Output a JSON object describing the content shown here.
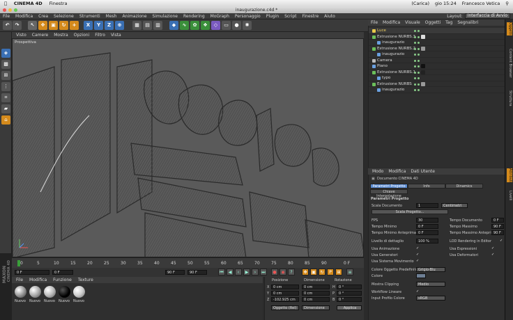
{
  "macbar": {
    "app": "CINEMA 4D",
    "menu": "Finestra",
    "charge": "(Carica)",
    "clock": "gio 15:24",
    "user": "Francesco Vetica"
  },
  "window": {
    "title": "inaugurazione.c4d *"
  },
  "menubar": {
    "items": [
      "File",
      "Modifica",
      "Crea",
      "Selezione",
      "Strumenti",
      "Mesh",
      "Animazione",
      "Simulazione",
      "Rendering",
      "MoGraph",
      "Personaggio",
      "Plugin",
      "Script",
      "Finestre",
      "Aiuto"
    ],
    "layout_label": "Layout:",
    "layout_value": "Interfaccia di Avvio"
  },
  "toolbar": {
    "x": "X",
    "y": "Y",
    "z": "Z"
  },
  "viewport": {
    "menu": [
      "Visto",
      "Camere",
      "Mostra",
      "Opzioni",
      "Filtro",
      "Vista"
    ],
    "label": "Prospettiva"
  },
  "timeline": {
    "ticks": [
      "0",
      "5",
      "10",
      "15",
      "20",
      "25",
      "30",
      "35",
      "40",
      "45",
      "50",
      "55",
      "60",
      "65",
      "70",
      "75",
      "80",
      "85",
      "90"
    ],
    "end_label": "0 F"
  },
  "transport": {
    "start": "0 F",
    "current": "0 F",
    "end": "90 F",
    "end2": "90 F"
  },
  "materials": {
    "menu": [
      "File",
      "Modifica",
      "Funzione",
      "Texture"
    ],
    "items": [
      {
        "name": "Nuovo"
      },
      {
        "name": "Nuovo"
      },
      {
        "name": "Nuovo"
      },
      {
        "name": "Nuovo"
      },
      {
        "name": "Nuovo"
      }
    ]
  },
  "maxon": {
    "brand": "MAXON",
    "product": "CINEMA 4D"
  },
  "coords": {
    "h_pos": "Posizione",
    "h_dim": "Dimensione",
    "h_rot": "Rotazione",
    "rows": [
      {
        "axis": "X",
        "pos": "0 cm",
        "dim": "0 cm",
        "rl": "H",
        "rot": "0 °"
      },
      {
        "axis": "Y",
        "pos": "0 cm",
        "dim": "0 cm",
        "rl": "P",
        "rot": "0 °"
      },
      {
        "axis": "Z",
        "pos": "-102.925 cm",
        "dim": "0 cm",
        "rl": "B",
        "rot": "0 °"
      }
    ],
    "mode1": "Oggetto (Rel)",
    "mode2": "Dimensione",
    "apply": "Applica"
  },
  "objects": {
    "menu": [
      "File",
      "Modifica",
      "Visuale",
      "Oggetti",
      "Tag",
      "Segnalibri"
    ],
    "rows": [
      {
        "name": "Luce",
        "indent": 0,
        "color": "#e8c84a"
      },
      {
        "name": "Estrusione NURBS.3",
        "indent": 0,
        "color": "#6bbf5a"
      },
      {
        "name": "inaugurazio",
        "indent": 1,
        "color": "#6aa0e0"
      },
      {
        "name": "Estrusione NURBS.2",
        "indent": 0,
        "color": "#6bbf5a"
      },
      {
        "name": "inaugurazio",
        "indent": 1,
        "color": "#6aa0e0"
      },
      {
        "name": "Camera",
        "indent": 0,
        "color": "#bbbbbb"
      },
      {
        "name": "Piano",
        "indent": 0,
        "color": "#6aa0e0"
      },
      {
        "name": "Estrusione NURBS.1",
        "indent": 0,
        "color": "#6bbf5a"
      },
      {
        "name": "typo",
        "indent": 1,
        "color": "#6aa0e0"
      },
      {
        "name": "Estrusione NURBS",
        "indent": 0,
        "color": "#6bbf5a"
      },
      {
        "name": "inaugurazio",
        "indent": 1,
        "color": "#6aa0e0"
      }
    ]
  },
  "sidetabs": [
    "Oggetti",
    "Content Browser",
    "Struttura",
    "Attributi",
    "Livelli"
  ],
  "attributes": {
    "menu": [
      "Modo",
      "Modifica",
      "Dati Utente"
    ],
    "doc": "Documento CINEMA 4D",
    "tabs": [
      "Parametri Progetto",
      "Info",
      "Dinamics"
    ],
    "tab2": "Chiave Interpolazione",
    "section": "Parametri Progetto",
    "scale_label": "Scala Documento",
    "scale_val": "1",
    "scale_unit": "Centimetri",
    "scale_btn": "Scala Progetto...",
    "fps_l": "FPS",
    "fps": "30",
    "tdoc_l": "Tempo Documento",
    "tdoc": "0 F",
    "tmin_l": "Tempo Minimo",
    "tmin": "0 F",
    "tmax_l": "Tempo Massimo",
    "tmax": "90 F",
    "tminp_l": "Tempo Minimo Anteprima",
    "tminp": "0 F",
    "tmaxp_l": "Tempo Massimo Anteprima",
    "tmaxp": "90 F",
    "lod_l": "Livello di dettaglio",
    "lod": "100 %",
    "lodr_l": "LOD Rendering in Editor",
    "c1": "Usa Animazione",
    "c2": "Usa Espressioni",
    "c3": "Usa Generatori",
    "c4": "Usa Deformatori",
    "c5": "Usa Sistema Movimento",
    "col_l": "Colore Oggetto Predefinito",
    "col": "Grigio-Blu",
    "colore_l": "Colore",
    "clip_l": "Mostra Clipping",
    "clip": "Medio",
    "wf_l": "Workflow Lineare",
    "prof_l": "Input Profilo Colore",
    "prof": "sRGB"
  }
}
